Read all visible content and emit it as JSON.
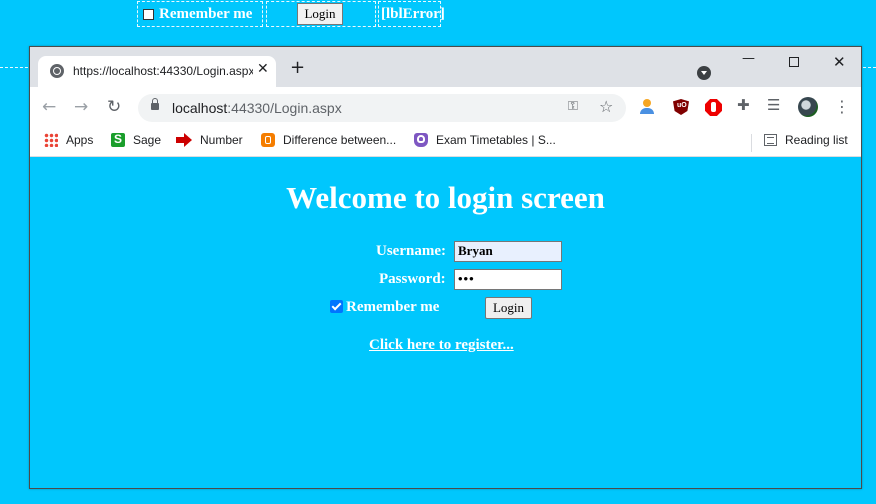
{
  "designer": {
    "remember_label": "Remember me",
    "login_label": "Login",
    "error_label": "[lblError]"
  },
  "browser": {
    "tab_title": "https://localhost:44330/Login.aspx",
    "url_host": "localhost",
    "url_path": ":44330/Login.aspx",
    "bookmarks": [
      {
        "label": "Apps",
        "icon": "apps-grid-icon"
      },
      {
        "label": "Sage",
        "icon": "sage-icon"
      },
      {
        "label": "Number",
        "icon": "red-arrow-icon"
      },
      {
        "label": "Difference between...",
        "icon": "blogger-icon"
      },
      {
        "label": "Exam Timetables | S...",
        "icon": "exam-icon"
      }
    ],
    "reading_list": "Reading list"
  },
  "page": {
    "heading": "Welcome to login screen",
    "username_label": "Username:",
    "username_value": "Bryan",
    "password_label": "Password:",
    "password_value": "•••",
    "remember_label": "Remember me",
    "remember_checked": true,
    "login_button": "Login",
    "register_link": "Click here to register..."
  },
  "colors": {
    "page_background": "#00c7fd",
    "checkbox_accent": "#0075ff"
  }
}
